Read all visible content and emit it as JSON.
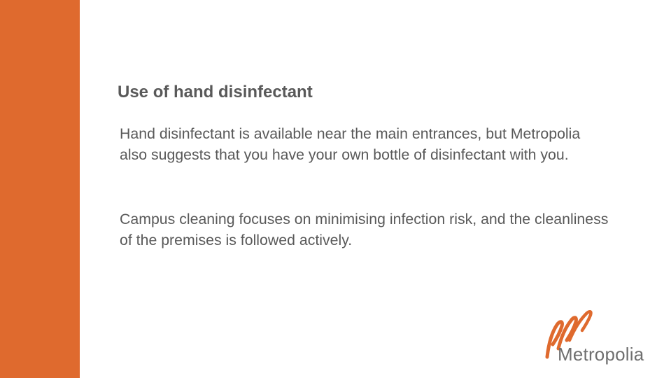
{
  "colors": {
    "accent": "#df6a2e",
    "text": "#595959",
    "logo_text": "#6f6f6f"
  },
  "slide": {
    "title": "Use of hand disinfectant",
    "paragraphs": [
      "Hand disinfectant is available near the main entrances, but Metropolia also suggests that you have your own bottle of disinfectant with you.",
      "Campus cleaning focuses on minimising infection risk, and the cleanliness of the premises is followed actively."
    ]
  },
  "logo": {
    "text": "Metropolia",
    "icon": "metropolia-swirl-icon"
  }
}
